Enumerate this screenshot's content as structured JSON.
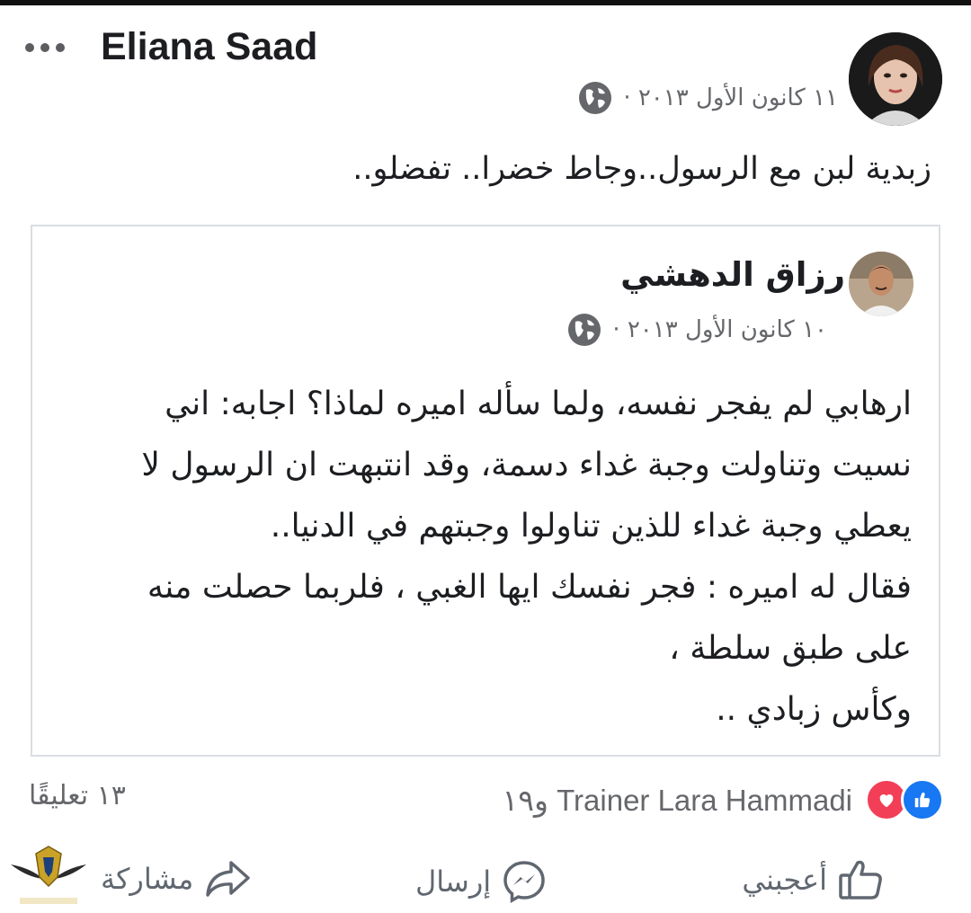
{
  "post": {
    "author": "Eliana Saad",
    "date": "١١ كانون الأول ٢٠١٣ ·",
    "text": "زبدية لبن مع الرسول..وجاط خضرا.. تفضلو.."
  },
  "shared_post": {
    "author": "رزاق الدهشي",
    "date": "١٠ كانون الأول ٢٠١٣ ·",
    "lines": [
      "ارهابي لم يفجر نفسه، ولما سأله اميره لماذا؟ اجابه: اني",
      "نسيت وتناولت وجبة غداء دسمة، وقد انتبهت ان الرسول لا",
      "يعطي وجبة غداء للذين تناولوا وجبتهم في الدنيا..",
      "فقال له اميره : فجر نفسك ايها الغبي ، فلربما حصلت منه",
      "على طبق سلطة ،",
      "وكأس زبادي .."
    ]
  },
  "reactions": {
    "text": "Trainer Lara Hammadi و١٩",
    "comments": "١٣ تعليقًا"
  },
  "actions": {
    "like": "أعجبني",
    "send": "إرسال",
    "share": "مشاركة"
  },
  "colors": {
    "like_blue": "#1877f2",
    "love_red": "#f33e58",
    "meta_gray": "#65676b"
  },
  "icons": [
    "more-icon",
    "globe-icon",
    "like-reaction-icon",
    "love-reaction-icon",
    "thumbs-up-icon",
    "messenger-icon",
    "share-icon"
  ]
}
